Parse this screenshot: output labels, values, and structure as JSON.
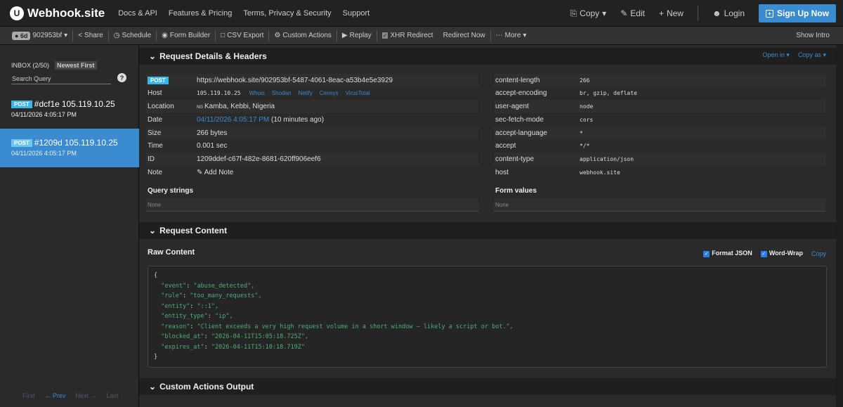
{
  "app": {
    "title": "Webhook.site",
    "logo_glyph": "U"
  },
  "topnav": [
    "Docs & API",
    "Features & Pricing",
    "Terms, Privacy & Security",
    "Support"
  ],
  "topright": {
    "copy": "Copy",
    "edit": "Edit",
    "new": "New",
    "login": "Login",
    "signup": "Sign Up Now"
  },
  "toolbar": {
    "age": "6d",
    "token": "902953bf",
    "items": [
      "Share",
      "Schedule",
      "Form Builder",
      "CSV Export",
      "Custom Actions",
      "Replay",
      "XHR Redirect",
      "Redirect Now",
      "More"
    ],
    "show_intro": "Show Intro"
  },
  "sidebar": {
    "inbox_label": "INBOX (2/50)",
    "sort": "Newest First",
    "search_placeholder": "Search Query",
    "help": "?",
    "requests": [
      {
        "method": "POST",
        "id": "#dcf1e",
        "ip": "105.119.10.25",
        "time": "04/11/2026 4:05:17 PM",
        "active": false
      },
      {
        "method": "POST",
        "id": "#1209d",
        "ip": "105.119.10.25",
        "time": "04/11/2026 4:05:17 PM",
        "active": true
      }
    ],
    "pager": {
      "first": "First",
      "prev": "← Prev",
      "next": "Next →",
      "last": "Last"
    }
  },
  "details": {
    "section_title": "Request Details & Headers",
    "open_in": "Open in",
    "copy_as": "Copy as",
    "method": "POST",
    "url": "https://webhook.site/902953bf-5487-4061-8eac-a53b4e5e3929",
    "host_label": "Host",
    "host_value": "105.119.10.25",
    "host_links": [
      "Whois",
      "Shodan",
      "Netify",
      "Censys",
      "VirusTotal"
    ],
    "location_label": "Location",
    "location_cc": "NG",
    "location_value": "Kamba, Kebbi, Nigeria",
    "date_label": "Date",
    "date_link": "04/11/2026 4:05:17 PM",
    "date_rel": "(10 minutes ago)",
    "size_label": "Size",
    "size_value": "266 bytes",
    "time_label": "Time",
    "time_value": "0.001 sec",
    "id_label": "ID",
    "id_value": "1209ddef-c67f-482e-8681-620ff906eef6",
    "note_label": "Note",
    "note_value": "Add Note",
    "headers": [
      {
        "k": "content-length",
        "v": "266"
      },
      {
        "k": "accept-encoding",
        "v": "br, gzip, deflate"
      },
      {
        "k": "user-agent",
        "v": "node"
      },
      {
        "k": "sec-fetch-mode",
        "v": "cors"
      },
      {
        "k": "accept-language",
        "v": "*"
      },
      {
        "k": "accept",
        "v": "*/*"
      },
      {
        "k": "content-type",
        "v": "application/json"
      },
      {
        "k": "host",
        "v": "webhook.site"
      }
    ],
    "query_strings": "Query strings",
    "form_values": "Form values",
    "none": "None"
  },
  "content": {
    "section_title": "Request Content",
    "raw_title": "Raw Content",
    "format_json": "Format JSON",
    "word_wrap": "Word-Wrap",
    "copy": "Copy",
    "json_lines": [
      {
        "k": "\"event\"",
        "v": "\"abuse_detected\","
      },
      {
        "k": "\"rule\"",
        "v": "\"too_many_requests\","
      },
      {
        "k": "\"entity\"",
        "v": "\"::1\","
      },
      {
        "k": "\"entity_type\"",
        "v": "\"ip\","
      },
      {
        "k": "\"reason\"",
        "v": "\"Client exceeds a very high request volume in a short window — likely a script or bot.\","
      },
      {
        "k": "\"blocked_at\"",
        "v": "\"2026-04-11T15:05:18.725Z\","
      },
      {
        "k": "\"expires_at\"",
        "v": "\"2026-04-11T15:10:18.719Z\""
      }
    ]
  },
  "custom_actions": {
    "section_title": "Custom Actions Output"
  }
}
